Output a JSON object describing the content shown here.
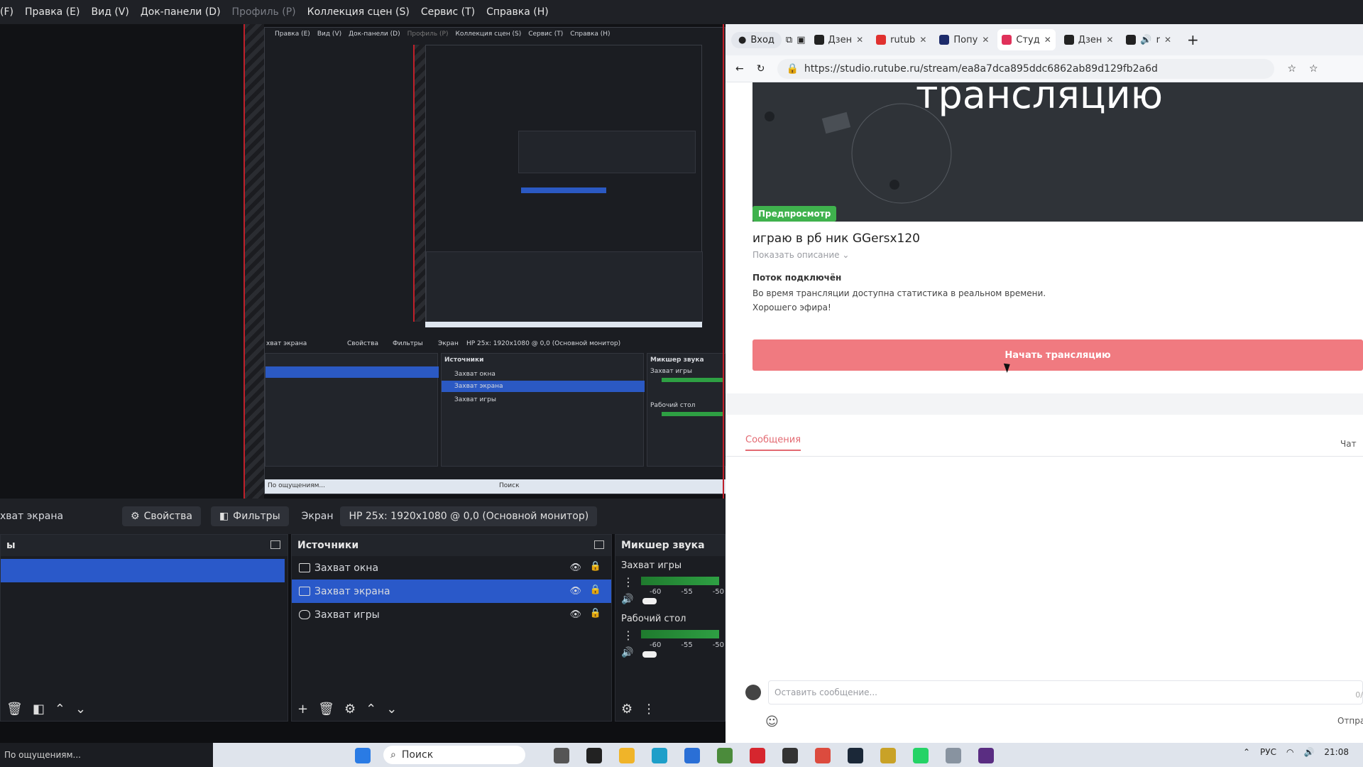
{
  "obs": {
    "menu": [
      "(F)",
      "Правка (E)",
      "Вид (V)",
      "Док-панели (D)",
      "Профиль (P)",
      "Коллекция сцен (S)",
      "Сервис (T)",
      "Справка (H)"
    ],
    "context_bar": {
      "source_label": "хват экрана",
      "properties": "Свойства",
      "filters": "Фильтры",
      "screen_label": "Экран",
      "monitor": "HP 25x: 1920x1080 @ 0,0 (Основной монитор)"
    },
    "scenes_dock": {
      "title": "ы"
    },
    "sources_dock": {
      "title": "Источники",
      "items": [
        {
          "label": "Захват окна",
          "selected": false,
          "icon": "window-icon"
        },
        {
          "label": "Захват экрана",
          "selected": true,
          "icon": "monitor-icon"
        },
        {
          "label": "Захват игры",
          "selected": false,
          "icon": "gamepad-icon"
        }
      ]
    },
    "mixer_dock": {
      "title": "Микшер звука",
      "channels": [
        {
          "name": "Захват игры",
          "ticks": [
            "-60",
            "-55",
            "-50"
          ]
        },
        {
          "name": "Рабочий стол",
          "ticks": [
            "-60",
            "-55",
            "-50"
          ]
        }
      ]
    },
    "nested": {
      "menu": [
        "Правка (E)",
        "Вид (V)",
        "Док-панели (D)",
        "Профиль (P)",
        "Коллекция сцен (S)",
        "Сервис (T)",
        "Справка (H)"
      ],
      "ctx": [
        "хват экрана",
        "Свойства",
        "Фильтры",
        "Экран",
        "HP 25x: 1920x1080 @ 0,0 (Основной монитор)"
      ],
      "sources_title": "Источники",
      "sources": [
        "Захват окна",
        "Захват экрана",
        "Захват игры"
      ],
      "mixer_title": "Микшер звука",
      "mixer": [
        "Захват игры",
        "Рабочий стол"
      ],
      "status": "По ощущениям...",
      "search": "Поиск"
    },
    "status_text": "По ощущениям..."
  },
  "browser": {
    "profile": "Вход",
    "tabs": [
      {
        "label": "Дзен",
        "color": "#222222",
        "active": false
      },
      {
        "label": "rutub",
        "color": "#e0312f",
        "active": false
      },
      {
        "label": "Попу",
        "color": "#1d2b6b",
        "active": false
      },
      {
        "label": "Студ",
        "color": "#e0315a",
        "active": true
      },
      {
        "label": "Дзен",
        "color": "#222222",
        "active": false
      },
      {
        "label": "r",
        "color": "#222222",
        "active": false
      }
    ],
    "url": "https://studio.rutube.ru/stream/ea8a7dca895ddc6862ab89d129fb2a6d",
    "hero_text": "трансляцию",
    "badge": "Предпросмотр",
    "stream_title": "играю в рб ник GGersx120",
    "show_description": "Показать описание",
    "status_heading": "Поток подключён",
    "status_lines": [
      "Во время трансляции доступна статистика в реальном времени.",
      "Хорошего эфира!"
    ],
    "start_button": "Начать трансляцию",
    "tab_messages": "Сообщения",
    "tab_chat": "Чат",
    "message_placeholder": "Оставить сообщение...",
    "message_count": "0/",
    "send": "Отпра"
  },
  "taskbar": {
    "search": "Поиск",
    "lang": "РУС",
    "time": "21:08"
  }
}
